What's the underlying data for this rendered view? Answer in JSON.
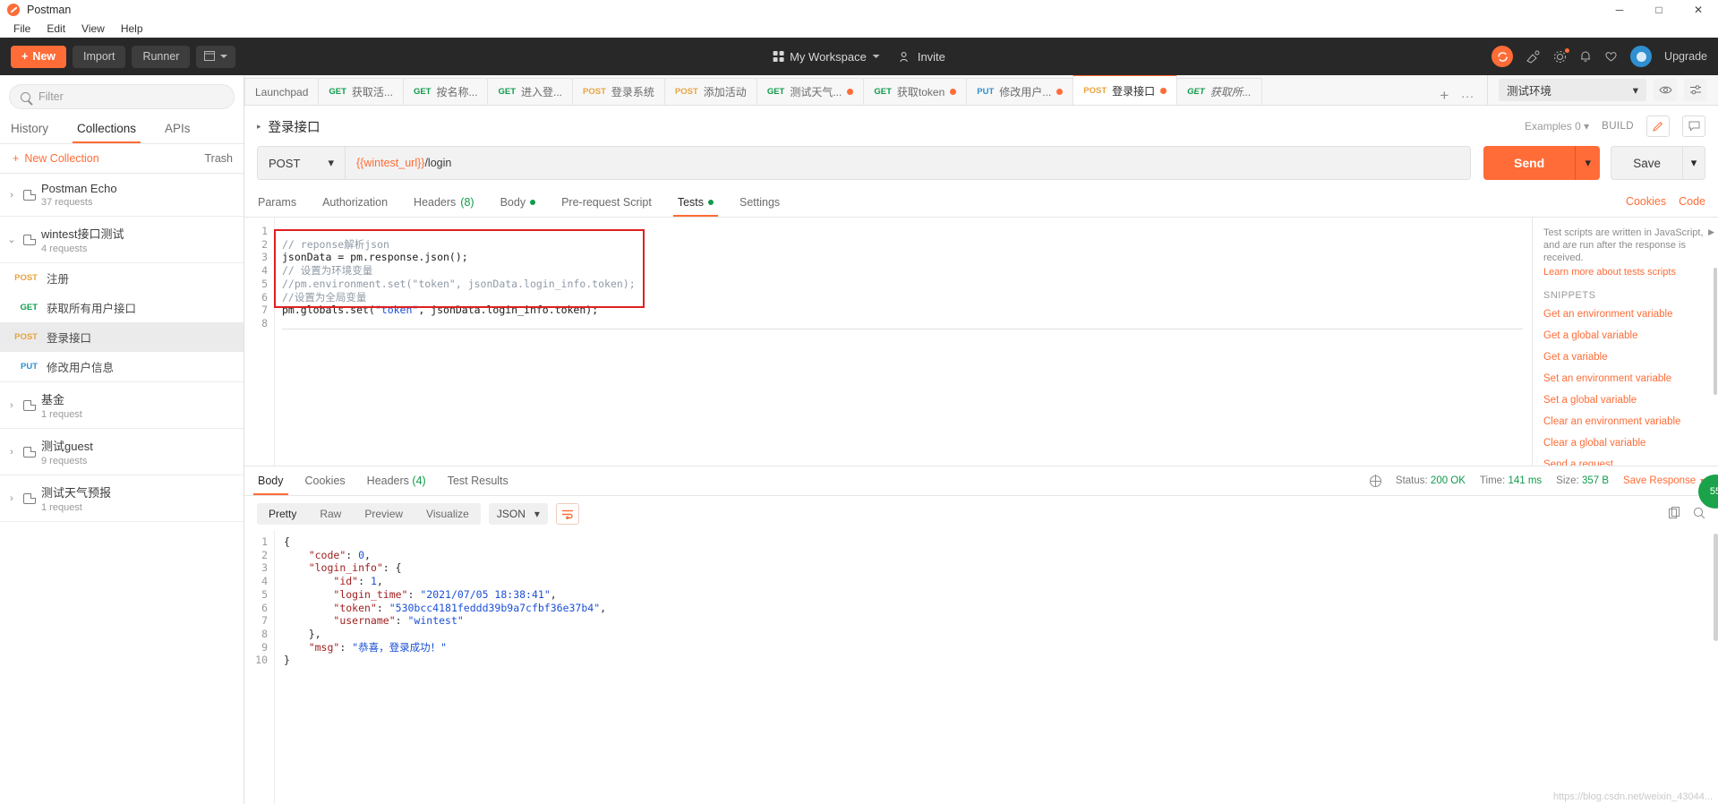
{
  "titlebar": {
    "app_name": "Postman",
    "minimize": "─",
    "maximize": "□",
    "close": "✕"
  },
  "menubar": [
    "File",
    "Edit",
    "View",
    "Help"
  ],
  "toolbar": {
    "new_label": "New",
    "new_plus": "+",
    "import_label": "Import",
    "runner_label": "Runner",
    "workspace_label": "My Workspace",
    "invite_label": "Invite",
    "upgrade_label": "Upgrade",
    "sync_icon": "sync-icon",
    "user_initial": ""
  },
  "sidebar": {
    "search_placeholder": "Filter",
    "tabs": [
      {
        "label": "History",
        "active": false
      },
      {
        "label": "Collections",
        "active": true
      },
      {
        "label": "APIs",
        "active": false
      }
    ],
    "new_collection_label": "New Collection",
    "trash_label": "Trash",
    "collections": [
      {
        "name": "Postman Echo",
        "count": "37 requests",
        "expanded": false,
        "chevron": "›",
        "requests": []
      },
      {
        "name": "wintest接口测试",
        "count": "4 requests",
        "expanded": true,
        "chevron": "⌄",
        "requests": [
          {
            "method": "POST",
            "cls": "post",
            "name": "注册",
            "selected": false
          },
          {
            "method": "GET",
            "cls": "get",
            "name": "获取所有用户接口",
            "selected": false
          },
          {
            "method": "POST",
            "cls": "post",
            "name": "登录接口",
            "selected": true
          },
          {
            "method": "PUT",
            "cls": "put",
            "name": "修改用户信息",
            "selected": false
          }
        ]
      },
      {
        "name": "基金",
        "count": "1 request",
        "expanded": false,
        "chevron": "›",
        "requests": []
      },
      {
        "name": "测试guest",
        "count": "9 requests",
        "expanded": false,
        "chevron": "›",
        "requests": []
      },
      {
        "name": "测试天气预报",
        "count": "1 request",
        "expanded": false,
        "chevron": "›",
        "requests": []
      }
    ]
  },
  "tabstrip": {
    "tabs": [
      {
        "method": "",
        "cls": "",
        "title": "Launchpad",
        "dirty": false,
        "active": false,
        "italic": false
      },
      {
        "method": "GET",
        "cls": "get",
        "title": "获取活...",
        "dirty": false,
        "active": false,
        "italic": false
      },
      {
        "method": "GET",
        "cls": "get",
        "title": "按名称...",
        "dirty": false,
        "active": false,
        "italic": false
      },
      {
        "method": "GET",
        "cls": "get",
        "title": "进入登...",
        "dirty": false,
        "active": false,
        "italic": false
      },
      {
        "method": "POST",
        "cls": "post",
        "title": "登录系统",
        "dirty": false,
        "active": false,
        "italic": false
      },
      {
        "method": "POST",
        "cls": "post",
        "title": "添加活动",
        "dirty": false,
        "active": false,
        "italic": false
      },
      {
        "method": "GET",
        "cls": "get",
        "title": "测试天气...",
        "dirty": true,
        "active": false,
        "italic": false
      },
      {
        "method": "GET",
        "cls": "get",
        "title": "获取token",
        "dirty": true,
        "active": false,
        "italic": false
      },
      {
        "method": "PUT",
        "cls": "put",
        "title": "修改用户...",
        "dirty": true,
        "active": false,
        "italic": false
      },
      {
        "method": "POST",
        "cls": "post",
        "title": "登录接口",
        "dirty": true,
        "active": true,
        "italic": false
      },
      {
        "method": "GET",
        "cls": "get",
        "title": "获取所...",
        "dirty": false,
        "active": false,
        "italic": true
      }
    ],
    "add_tab": "+",
    "more_tabs": "∙∙∙",
    "environment": "测试环境",
    "env_caret": "▾",
    "eye_icon": "eye-icon",
    "sliders_icon": "sliders-icon"
  },
  "request": {
    "breadcrumb_title": "登录接口",
    "expand_tri": "▸",
    "examples_label": "Examples",
    "examples_count": "0",
    "examples_caret": "▾",
    "build_label": "BUILD",
    "edit_icon": "pencil-icon",
    "comment_icon": "comment-icon",
    "method": "POST",
    "method_caret": "▾",
    "url_variable": "{{wintest_url}}",
    "url_path": "/login",
    "send_label": "Send",
    "send_caret": "▾",
    "save_label": "Save",
    "save_caret": "▾",
    "subtabs": [
      {
        "label": "Params",
        "active": false,
        "dot": false,
        "count": ""
      },
      {
        "label": "Authorization",
        "active": false,
        "dot": false,
        "count": ""
      },
      {
        "label": "Headers",
        "active": false,
        "dot": false,
        "count": "(8)"
      },
      {
        "label": "Body",
        "active": false,
        "dot": true,
        "count": ""
      },
      {
        "label": "Pre-request Script",
        "active": false,
        "dot": false,
        "count": ""
      },
      {
        "label": "Tests",
        "active": true,
        "dot": true,
        "count": ""
      },
      {
        "label": "Settings",
        "active": false,
        "dot": false,
        "count": ""
      }
    ],
    "cookies_link": "Cookies",
    "code_link": "Code"
  },
  "editor": {
    "line_numbers": [
      "1",
      "2",
      "3",
      "4",
      "5",
      "6",
      "7",
      "8"
    ],
    "lines": [
      {
        "parts": []
      },
      {
        "parts": [
          {
            "t": "// reponse解析json",
            "c": "c-comment"
          }
        ]
      },
      {
        "parts": [
          {
            "t": "jsonData = pm.response.json();",
            "c": "c-plain"
          }
        ]
      },
      {
        "parts": [
          {
            "t": "// 设置为环境变量",
            "c": "c-comment"
          }
        ]
      },
      {
        "parts": [
          {
            "t": "//pm.environment.set(\"token\", jsonData.login_info.token);",
            "c": "c-comment"
          }
        ]
      },
      {
        "parts": [
          {
            "t": "//设置为全局变量",
            "c": "c-comment"
          }
        ]
      },
      {
        "parts": [
          {
            "t": "pm.globals.set(",
            "c": "c-plain"
          },
          {
            "t": "\"token\"",
            "c": "c-str"
          },
          {
            "t": ", jsonData.login_info.token);",
            "c": "c-plain"
          }
        ]
      },
      {
        "parts": []
      }
    ],
    "snippets": {
      "description": "Test scripts are written in JavaScript, and are run after the response is received.",
      "learn_more": "Learn more about tests scripts",
      "heading": "SNIPPETS",
      "items": [
        "Get an environment variable",
        "Get a global variable",
        "Get a variable",
        "Set an environment variable",
        "Set a global variable",
        "Clear an environment variable",
        "Clear a global variable",
        "Send a request"
      ],
      "collapse_arrow": "▶"
    }
  },
  "response": {
    "tabs": [
      {
        "label": "Body",
        "active": true,
        "count": ""
      },
      {
        "label": "Cookies",
        "active": false,
        "count": ""
      },
      {
        "label": "Headers",
        "active": false,
        "count": "(4)"
      },
      {
        "label": "Test Results",
        "active": false,
        "count": ""
      }
    ],
    "status_label": "Status:",
    "status_value": "200 OK",
    "time_label": "Time:",
    "time_value": "141 ms",
    "size_label": "Size:",
    "size_value": "357 B",
    "save_response": "Save Response",
    "save_response_caret": "▾",
    "globe_icon": "globe-icon",
    "view_modes": [
      {
        "label": "Pretty",
        "on": true
      },
      {
        "label": "Raw",
        "on": false
      },
      {
        "label": "Preview",
        "on": false
      },
      {
        "label": "Visualize",
        "on": false
      }
    ],
    "format": "JSON",
    "format_caret": "▾",
    "wrap_icon": "wrap-lines-icon",
    "copy_icon": "copy-icon",
    "search_icon": "search-icon",
    "line_numbers": [
      "1",
      "2",
      "3",
      "4",
      "5",
      "6",
      "7",
      "8",
      "9",
      "10"
    ],
    "lines": [
      {
        "parts": [
          {
            "t": "{",
            "c": "j-pun"
          }
        ]
      },
      {
        "parts": [
          {
            "t": "    ",
            "c": "j-pun"
          },
          {
            "t": "\"code\"",
            "c": "j-key"
          },
          {
            "t": ": ",
            "c": "j-pun"
          },
          {
            "t": "0",
            "c": "j-num"
          },
          {
            "t": ",",
            "c": "j-pun"
          }
        ]
      },
      {
        "parts": [
          {
            "t": "    ",
            "c": "j-pun"
          },
          {
            "t": "\"login_info\"",
            "c": "j-key"
          },
          {
            "t": ": {",
            "c": "j-pun"
          }
        ]
      },
      {
        "parts": [
          {
            "t": "        ",
            "c": "j-pun"
          },
          {
            "t": "\"id\"",
            "c": "j-key"
          },
          {
            "t": ": ",
            "c": "j-pun"
          },
          {
            "t": "1",
            "c": "j-num"
          },
          {
            "t": ",",
            "c": "j-pun"
          }
        ]
      },
      {
        "parts": [
          {
            "t": "        ",
            "c": "j-pun"
          },
          {
            "t": "\"login_time\"",
            "c": "j-key"
          },
          {
            "t": ": ",
            "c": "j-pun"
          },
          {
            "t": "\"2021/07/05 18:38:41\"",
            "c": "j-str"
          },
          {
            "t": ",",
            "c": "j-pun"
          }
        ]
      },
      {
        "parts": [
          {
            "t": "        ",
            "c": "j-pun"
          },
          {
            "t": "\"token\"",
            "c": "j-key"
          },
          {
            "t": ": ",
            "c": "j-pun"
          },
          {
            "t": "\"530bcc4181feddd39b9a7cfbf36e37b4\"",
            "c": "j-str"
          },
          {
            "t": ",",
            "c": "j-pun"
          }
        ]
      },
      {
        "parts": [
          {
            "t": "        ",
            "c": "j-pun"
          },
          {
            "t": "\"username\"",
            "c": "j-key"
          },
          {
            "t": ": ",
            "c": "j-pun"
          },
          {
            "t": "\"wintest\"",
            "c": "j-str"
          }
        ]
      },
      {
        "parts": [
          {
            "t": "    },",
            "c": "j-pun"
          }
        ]
      },
      {
        "parts": [
          {
            "t": "    ",
            "c": "j-pun"
          },
          {
            "t": "\"msg\"",
            "c": "j-key"
          },
          {
            "t": ": ",
            "c": "j-pun"
          },
          {
            "t": "\"恭喜，登录成功！\"",
            "c": "j-str"
          }
        ]
      },
      {
        "parts": [
          {
            "t": "}",
            "c": "j-pun"
          }
        ]
      }
    ],
    "watermark": "https://blog.csdn.net/weixin_43044..."
  },
  "colors": {
    "accent": "#ff6c37",
    "get": "#0e9b4a",
    "post": "#e8a33d",
    "put": "#2f8fd1",
    "highlight_box": "#e01f1f"
  }
}
